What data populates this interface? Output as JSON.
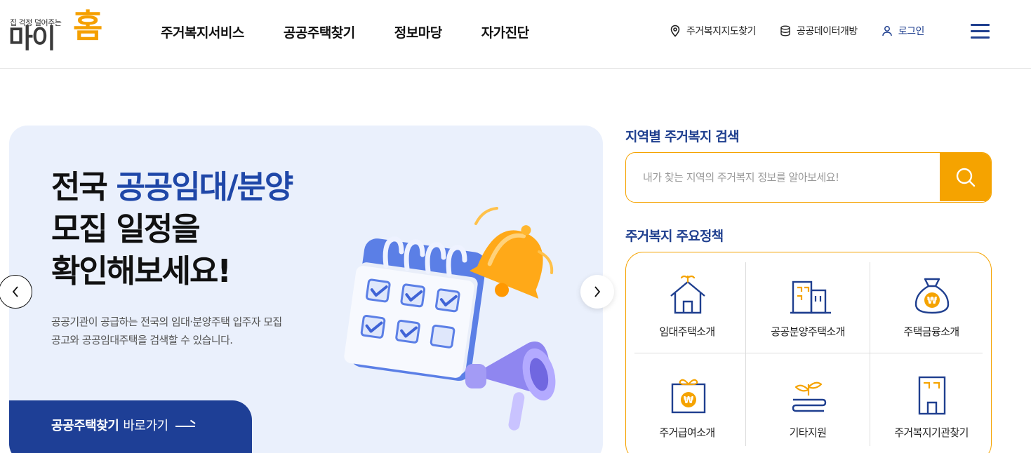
{
  "header": {
    "logo": {
      "tagline": "집 걱정 덜어주는",
      "name_a": "마이",
      "name_b": "홈"
    },
    "nav": [
      "주거복지서비스",
      "공공주택찾기",
      "정보마당",
      "자가진단"
    ],
    "util": {
      "map_label": "주거복지지도찾기",
      "data_label": "공공데이터개방",
      "login_label": "로그인"
    }
  },
  "banner": {
    "title_part1": "전국 ",
    "title_highlight": "공공임대/분양",
    "title_line2": "모집 일정을",
    "title_line3": "확인해보세요!",
    "description": "공공기관이 공급하는 전국의 임대·분양주택 입주자 모집공고와 공공임대주택을 검색할 수 있습니다.",
    "cta_bold": "공공주택찾기",
    "cta_rest": "바로가기"
  },
  "search": {
    "title": "지역별 주거복지 검색",
    "placeholder": "내가 찾는 지역의 주거복지 정보를 알아보세요!"
  },
  "policies": {
    "title": "주거복지 주요정책",
    "items": [
      {
        "label": "임대주택소개",
        "icon": "house-sprout-icon"
      },
      {
        "label": "공공분양주택소개",
        "icon": "buildings-icon"
      },
      {
        "label": "주택금융소개",
        "icon": "money-bag-icon"
      },
      {
        "label": "주거급여소개",
        "icon": "gift-box-icon"
      },
      {
        "label": "기타지원",
        "icon": "sprout-hand-icon"
      },
      {
        "label": "주거복지기관찾기",
        "icon": "office-building-icon"
      }
    ]
  },
  "colors": {
    "primary": "#1f3f8f",
    "accent": "#f5a300",
    "banner_bg": "#eaf0fc"
  }
}
